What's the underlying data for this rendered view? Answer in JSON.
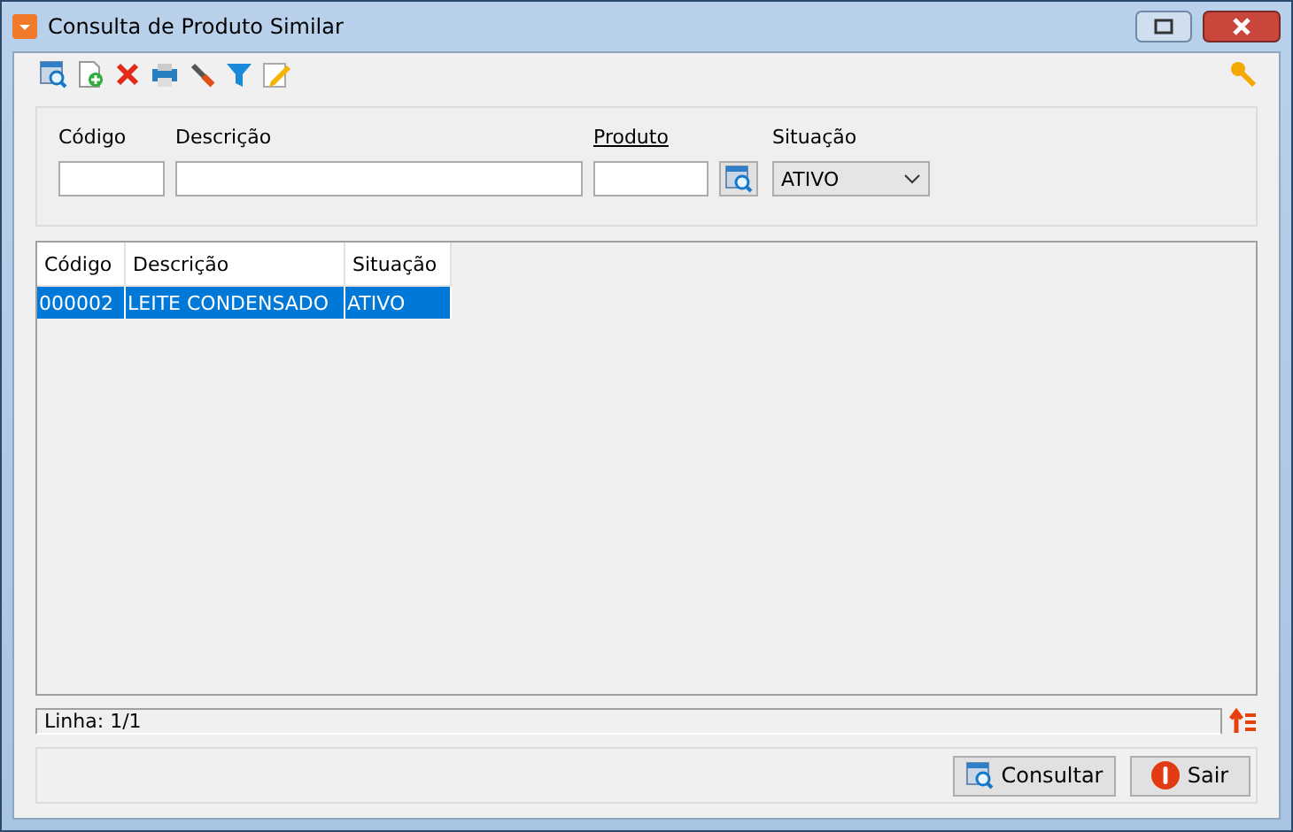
{
  "window": {
    "title": "Consulta de Produto Similar"
  },
  "filters": {
    "codigo": {
      "label": "Código"
    },
    "descricao": {
      "label": "Descrição"
    },
    "produto": {
      "label": "Produto"
    },
    "situacao": {
      "label": "Situação",
      "value": "ATIVO"
    }
  },
  "table": {
    "columns": [
      "Código",
      "Descrição",
      "Situação"
    ],
    "rows": [
      {
        "cells": [
          "000002",
          "LEITE CONDENSADO",
          "ATIVO"
        ],
        "selected": true
      }
    ]
  },
  "status_bar": "Linha: 1/1",
  "buttons": [
    {
      "label": "Consultar",
      "kind": "search"
    },
    {
      "label": "Sair",
      "kind": "exit"
    }
  ]
}
